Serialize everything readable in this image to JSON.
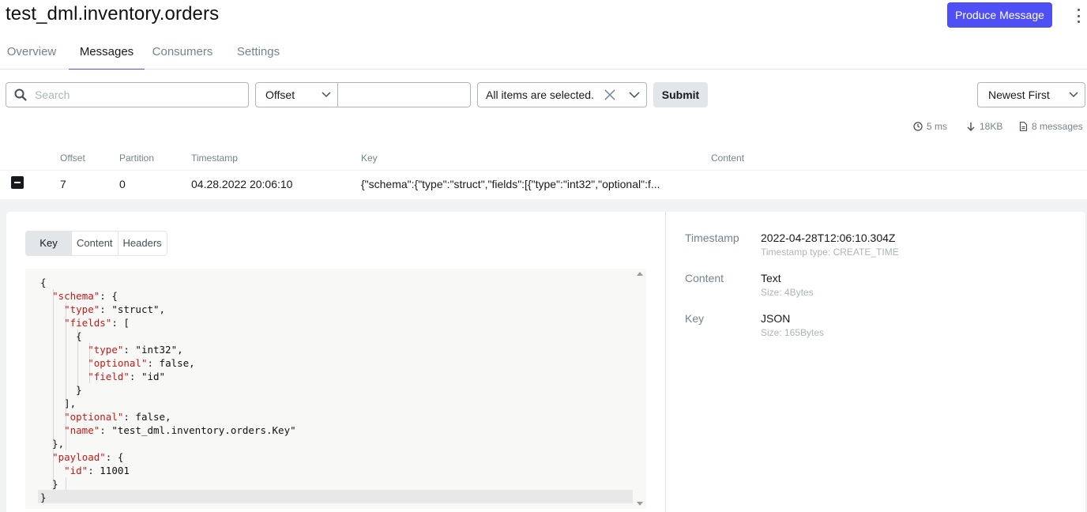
{
  "header": {
    "title": "test_dml.inventory.orders",
    "produce_label": "Produce Message",
    "accent": "#4f4ff6"
  },
  "tabs": [
    {
      "label": "Overview",
      "active": false
    },
    {
      "label": "Messages",
      "active": true
    },
    {
      "label": "Consumers",
      "active": false
    },
    {
      "label": "Settings",
      "active": false
    }
  ],
  "filters": {
    "search_placeholder": "Search",
    "seek_type": "Offset",
    "seek_value": "",
    "partitions": "All items are selected.",
    "submit_label": "Submit",
    "sort": "Newest First"
  },
  "stats": {
    "time": "5 ms",
    "size": "18KB",
    "messages": "8 messages"
  },
  "table": {
    "headers": [
      "Offset",
      "Partition",
      "Timestamp",
      "Key",
      "Content"
    ],
    "rows": [
      {
        "offset": "7",
        "partition": "0",
        "timestamp": "04.28.2022 20:06:10",
        "key": "{\"schema\":{\"type\":\"struct\",\"fields\":[{\"type\":\"int32\",\"optional\":f...",
        "content": ""
      }
    ]
  },
  "detail": {
    "tabs": [
      "Key",
      "Content",
      "Headers"
    ],
    "active_tab": "Key",
    "code_lines": [
      "{",
      "  \"schema\": {",
      "    \"type\": \"struct\",",
      "    \"fields\": [",
      "      {",
      "        \"type\": \"int32\",",
      "        \"optional\": false,",
      "        \"field\": \"id\"",
      "      }",
      "    ],",
      "    \"optional\": false,",
      "    \"name\": \"test_dml.inventory.orders.Key\"",
      "  },",
      "  \"payload\": {",
      "    \"id\": 11001",
      "  }",
      "}"
    ],
    "meta": {
      "timestamp_label": "Timestamp",
      "timestamp_value": "2022-04-28T12:06:10.304Z",
      "timestamp_sub": "Timestamp type: CREATE_TIME",
      "content_label": "Content",
      "content_value": "Text",
      "content_sub": "Size: 4Bytes",
      "key_label": "Key",
      "key_value": "JSON",
      "key_sub": "Size: 165Bytes"
    }
  }
}
